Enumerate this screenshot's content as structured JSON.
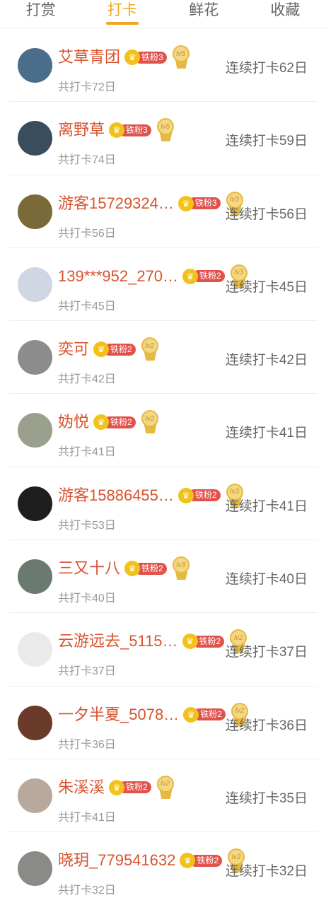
{
  "tabs": [
    {
      "label": "打赏",
      "active": false
    },
    {
      "label": "打卡",
      "active": true
    },
    {
      "label": "鲜花",
      "active": false
    },
    {
      "label": "收藏",
      "active": false
    }
  ],
  "colors": {
    "accent": "#f0a51c",
    "name": "#d9532f",
    "badge": "#e2524c",
    "crown": "#f2c21a"
  },
  "rows": [
    {
      "name": "艾草青团",
      "fan": "铁粉3",
      "level": "lv5",
      "total": "共打卡72日",
      "streak": "连续打卡62日",
      "avatar": "#4a6e8a"
    },
    {
      "name": "离野草",
      "fan": "铁粉3",
      "level": "lv5",
      "total": "共打卡74日",
      "streak": "连续打卡59日",
      "avatar": "#3a4d5c"
    },
    {
      "name": "游客15729324…",
      "fan": "铁粉3",
      "level": "lv3",
      "total": "共打卡56日",
      "streak": "连续打卡56日",
      "avatar": "#7a6a3a"
    },
    {
      "name": "139***952_270…",
      "fan": "铁粉2",
      "level": "lv3",
      "total": "共打卡45日",
      "streak": "连续打卡45日",
      "avatar": "#d0d6e4"
    },
    {
      "name": "奕可",
      "fan": "铁粉2",
      "level": "lv2",
      "total": "共打卡42日",
      "streak": "连续打卡42日",
      "avatar": "#8c8c8c"
    },
    {
      "name": "妫悦",
      "fan": "铁粉2",
      "level": "lv2",
      "total": "共打卡41日",
      "streak": "连续打卡41日",
      "avatar": "#9aa08c"
    },
    {
      "name": "游客15886455…",
      "fan": "铁粉2",
      "level": "lv3",
      "total": "共打卡53日",
      "streak": "连续打卡41日",
      "avatar": "#1e1e1e"
    },
    {
      "name": "三又十八",
      "fan": "铁粉2",
      "level": "lv3",
      "total": "共打卡40日",
      "streak": "连续打卡40日",
      "avatar": "#6a7a70"
    },
    {
      "name": "云游远去_5115…",
      "fan": "铁粉2",
      "level": "lv2",
      "total": "共打卡37日",
      "streak": "连续打卡37日",
      "avatar": "#eaeaea"
    },
    {
      "name": "一夕半夏_5078…",
      "fan": "铁粉2",
      "level": "lv2",
      "total": "共打卡36日",
      "streak": "连续打卡36日",
      "avatar": "#6a3a2a"
    },
    {
      "name": "朱溪溪",
      "fan": "铁粉2",
      "level": "lv2",
      "total": "共打卡41日",
      "streak": "连续打卡35日",
      "avatar": "#b9a99c"
    },
    {
      "name": "晓玥_779541632",
      "fan": "铁粉2",
      "level": "lv2",
      "total": "共打卡32日",
      "streak": "连续打卡32日",
      "avatar": "#8a8a86"
    }
  ]
}
